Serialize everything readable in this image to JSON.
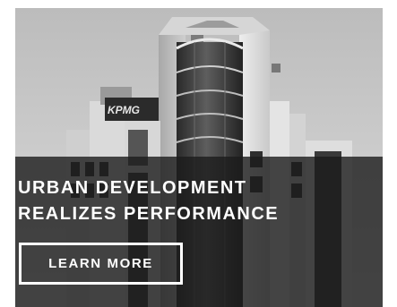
{
  "hero": {
    "sign_text": "KPMG",
    "headline": {
      "line1": "URBAN DEVELOPMENT",
      "line2": "REALIZES PERFORMANCE"
    },
    "cta_label": "LEARN MORE"
  }
}
